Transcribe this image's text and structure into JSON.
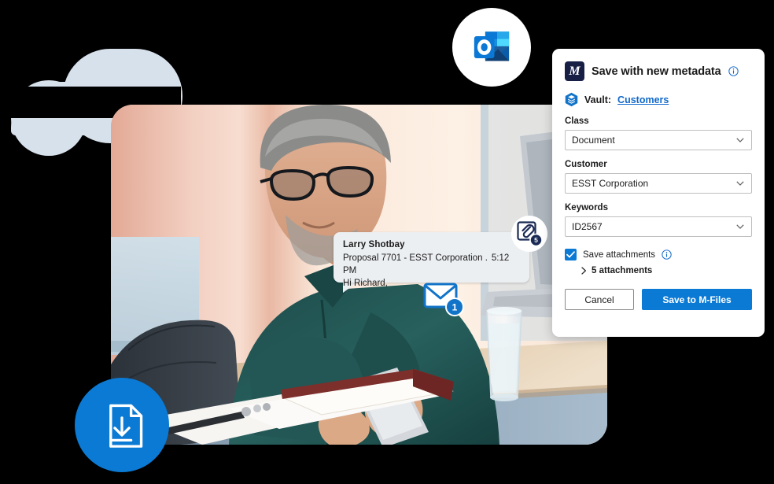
{
  "background": {
    "cloud_color": "#d7e1ec",
    "canvas_color": "#000000"
  },
  "badges": {
    "outlook": {
      "name": "Outlook",
      "icon": "outlook-icon"
    },
    "document_download": {
      "name": "Document download",
      "icon": "document-download-icon",
      "color": "#0b7ad4"
    },
    "envelope": {
      "icon": "envelope-icon",
      "count": "1",
      "color": "#1274c9"
    },
    "attachment": {
      "icon": "paperclip-icon",
      "count": "5",
      "color": "#1b2a55"
    }
  },
  "chat": {
    "sender": "Larry Shotbay",
    "subject": "Proposal 7701 - ESST Corporation .",
    "time": "5:12 PM",
    "greeting": "Hi Richard,"
  },
  "dialog": {
    "logo_letter": "M",
    "title": "Save with new metadata",
    "title_info_icon": "info-icon",
    "vault": {
      "icon": "vault-icon",
      "label": "Vault:",
      "value": "Customers"
    },
    "fields": [
      {
        "label": "Class",
        "value": "Document",
        "icon": "chevron-down-icon"
      },
      {
        "label": "Customer",
        "value": "ESST Corporation",
        "icon": "chevron-down-icon"
      },
      {
        "label": "Keywords",
        "value": "ID2567",
        "icon": "chevron-down-icon"
      }
    ],
    "save_attachments": {
      "checked": true,
      "label": "Save attachments",
      "info_icon": "info-icon",
      "expander_icon": "chevron-right-icon",
      "count_label": "5 attachments"
    },
    "buttons": {
      "cancel": "Cancel",
      "save": "Save to M-Files"
    },
    "accent_color": "#0b7ad4",
    "link_color": "#1169c9"
  }
}
